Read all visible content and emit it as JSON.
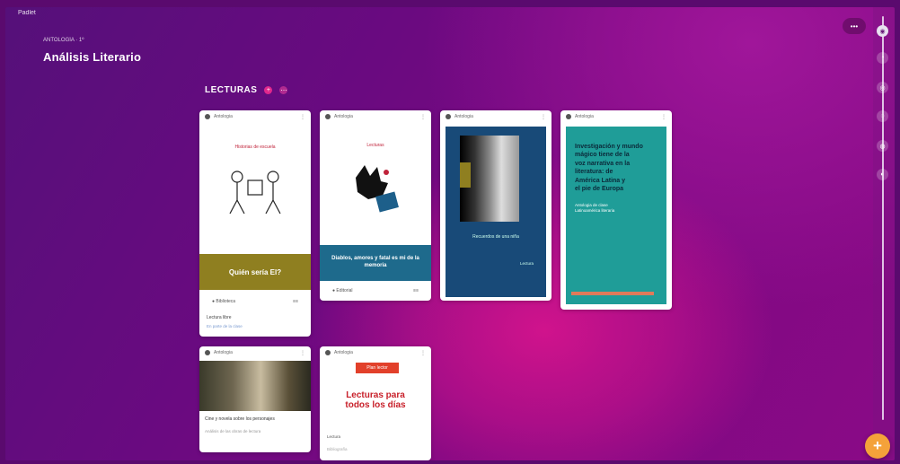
{
  "app": {
    "topbar_label": "Padlet"
  },
  "header": {
    "breadcrumb": "ANTOLOGÍA · 1º",
    "title": "Análisis Literario"
  },
  "section": {
    "title": "LECTURAS",
    "badges": [
      "+",
      "⋯"
    ]
  },
  "toolbar": {
    "pill_icon": "•••"
  },
  "rail": {
    "buttons": [
      "◉",
      "◔",
      "◎",
      "◌",
      "◍",
      "◐"
    ]
  },
  "fab": {
    "label": "+"
  },
  "cards": [
    {
      "author": "Antologia",
      "banner_title": "Historias de escuela",
      "strip_text": "Quién sería El?",
      "footer_left": "● Biblioteca",
      "footer_right": "≡≡",
      "caption": "Lectura libre",
      "caption_sub": "En parte de la clase"
    },
    {
      "author": "Antologia",
      "banner_title": "Lecturas",
      "strip_text": "Diablos, amores y fatal es mi de la memoria",
      "footer_left": "● Editorial",
      "footer_right": "≡≡"
    },
    {
      "author": "Antologia",
      "cover_caption": "Recuerdos de una niña",
      "cover_sub": "Lectura"
    },
    {
      "author": "Antologia",
      "text_lines": [
        "Investigación y mundo",
        "mágico tiene de la",
        "voz narrativa en la",
        "literatura: de",
        "América Latina y",
        "el pie de Europa"
      ],
      "sub_lines": [
        "Antologia de clase",
        "Latinoamérica literaria"
      ]
    },
    {
      "author": "Antologia",
      "caption": "Cine y novela sobre los personajes",
      "caption_sub": "Análisis de las obras de lectura"
    },
    {
      "author": "Antologia",
      "tag": "Plan lector",
      "headline": "Lecturas para todos los días",
      "foot": "Lectura",
      "foot_sub": "Bibliografía"
    }
  ],
  "colors": {
    "accent": "#e0288c",
    "fab": "#f4a23a",
    "teal": "#1f9d98",
    "navy": "#184a78",
    "olive": "#8f7f20"
  }
}
